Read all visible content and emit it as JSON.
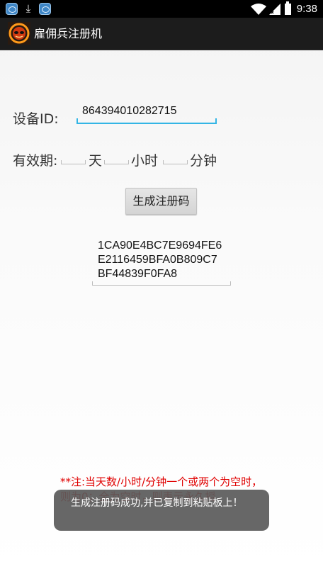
{
  "status_bar": {
    "time": "9:38",
    "icons": [
      "app-notification-icon",
      "download-icon",
      "app-notification-icon",
      "wifi-icon",
      "signal-icon",
      "battery-icon"
    ]
  },
  "app_bar": {
    "title": "雇佣兵注册机",
    "icon": "app-logo-icon"
  },
  "form": {
    "device_id_label": "设备ID:",
    "device_id_value": "864394010282715",
    "validity_label": "有效期:",
    "days_unit": "天",
    "hours_unit": "小时",
    "minutes_unit": "分钟",
    "days_value": "",
    "hours_value": "",
    "minutes_value": ""
  },
  "generate_button_label": "生成注册码",
  "registration_code": "1CA90E4BC7E9694FE6\nE2116459BFA0B809C7\nBF44839F0FA8",
  "note_text": "**注:当天数/小时/分钟一个或两个为空时，则为0；全为空时，则表示永久授",
  "toast_text": "生成注册码成功,并已复制到粘贴板上！",
  "colors": {
    "accent": "#33b5e5",
    "note": "#e00000",
    "app_bar": "#1c1c1c"
  }
}
